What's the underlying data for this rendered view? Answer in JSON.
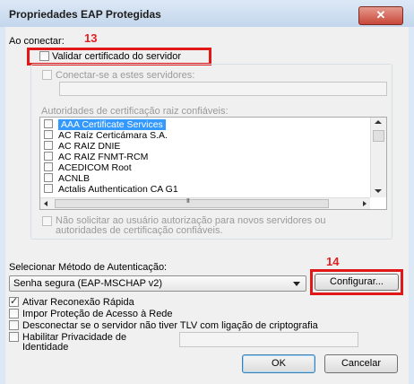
{
  "window": {
    "title": "Propriedades EAP Protegidas",
    "close_glyph": "✕"
  },
  "annotations": {
    "step13": "13",
    "step14": "14"
  },
  "connect": {
    "label": "Ao conectar:",
    "validate_cert": "Validar certificado do servidor",
    "connect_servers": "Conectar-se a estes servidores:",
    "servers_value": "",
    "trusted_roots_label": "Autoridades de certificação raiz confiáveis:",
    "trusted_roots": [
      "AAA Certificate Services",
      "AC Raíz Certicámara S.A.",
      "AC RAIZ DNIE",
      "AC RAIZ FNMT-RCM",
      "ACEDICOM Root",
      "ACNLB",
      "Actalis Authentication CA G1"
    ],
    "hscroll_grip": "III",
    "no_prompt_line1": "Não solicitar ao usuário autorização para novos servidores ou",
    "no_prompt_line2": "autoridades de certificação confiáveis."
  },
  "auth": {
    "label": "Selecionar Método de Autenticação:",
    "method": "Senha segura (EAP-MSCHAP v2)",
    "configure_button": "Configurar..."
  },
  "options": {
    "fast_reconnect": "Ativar Reconexão Rápida",
    "nap": "Impor Proteção de Acesso à Rede",
    "disconnect_tlv": "Desconectar se o servidor não tiver TLV com ligação de criptografia",
    "privacy_line1": "Habilitar Privacidade de",
    "privacy_line2": "Identidade",
    "identity_value": ""
  },
  "buttons": {
    "ok": "OK",
    "cancel": "Cancelar"
  }
}
